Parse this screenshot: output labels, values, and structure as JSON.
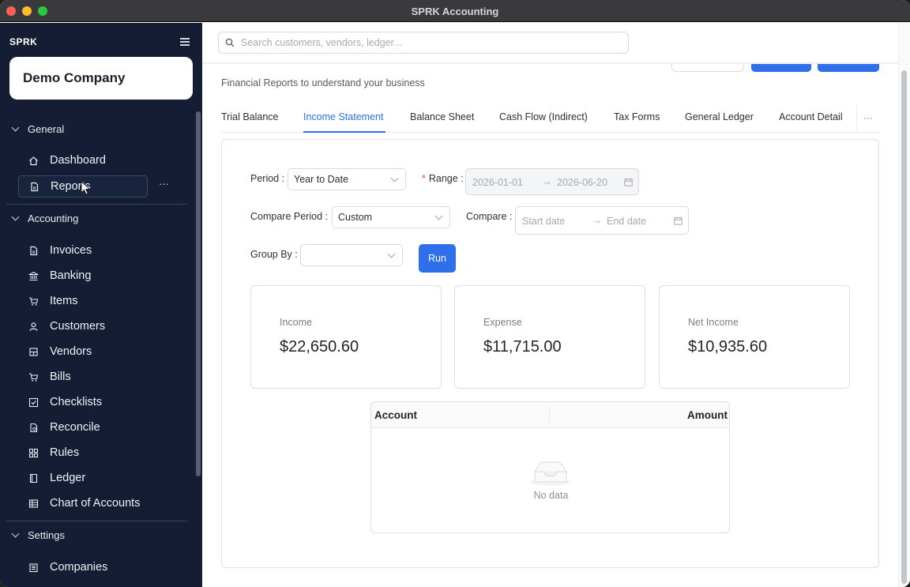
{
  "window": {
    "title": "SPRK Accounting"
  },
  "sidebar": {
    "brand": "SPRK",
    "company": "Demo Company",
    "sections": [
      {
        "label": "General",
        "items": [
          {
            "label": "Dashboard",
            "icon": "home-icon"
          },
          {
            "label": "Reports",
            "icon": "document-icon"
          }
        ]
      },
      {
        "label": "Accounting",
        "items": [
          {
            "label": "Invoices",
            "icon": "document-icon"
          },
          {
            "label": "Banking",
            "icon": "bank-icon"
          },
          {
            "label": "Items",
            "icon": "cart-icon"
          },
          {
            "label": "Customers",
            "icon": "user-icon"
          },
          {
            "label": "Vendors",
            "icon": "shop-icon"
          },
          {
            "label": "Bills",
            "icon": "cart-icon"
          },
          {
            "label": "Checklists",
            "icon": "checkbox-icon"
          },
          {
            "label": "Reconcile",
            "icon": "reconcile-icon"
          },
          {
            "label": "Rules",
            "icon": "grid-icon"
          },
          {
            "label": "Ledger",
            "icon": "book-icon"
          },
          {
            "label": "Chart of Accounts",
            "icon": "table-icon"
          }
        ]
      },
      {
        "label": "Settings",
        "items": [
          {
            "label": "Companies",
            "icon": "building-icon"
          }
        ]
      }
    ]
  },
  "search": {
    "placeholder": "Search customers, vendors, ledger..."
  },
  "page": {
    "subtitle": "Financial Reports to understand your business"
  },
  "tabs": [
    "Trial Balance",
    "Income Statement",
    "Balance Sheet",
    "Cash Flow (Indirect)",
    "Tax Forms",
    "General Ledger",
    "Account Detail"
  ],
  "tabs_active": "Income Statement",
  "tabs_more": "···",
  "filters": {
    "period_label": "Period",
    "period_value": "Year to Date",
    "range_label": "Range",
    "range_required": "*",
    "range_start": "2026-01-01",
    "range_end": "2026-06-20",
    "compare_period_label": "Compare Period",
    "compare_period_value": "Custom",
    "compare_label": "Compare",
    "compare_start_placeholder": "Start date",
    "compare_end_placeholder": "End date",
    "group_by_label": "Group By",
    "group_by_value": "",
    "colon": ":",
    "arrow": "→",
    "run_label": "Run"
  },
  "summary": [
    {
      "label": "Income",
      "value": "$22,650.60"
    },
    {
      "label": "Expense",
      "value": "$11,715.00"
    },
    {
      "label": "Net Income",
      "value": "$10,935.60"
    }
  ],
  "table": {
    "columns": [
      "Account",
      "Amount"
    ],
    "empty_text": "No data"
  },
  "colors": {
    "sidebar_bg": "#141d33",
    "accent": "#2f6fec",
    "required": "#e5484d"
  },
  "sidebar_more": "···"
}
